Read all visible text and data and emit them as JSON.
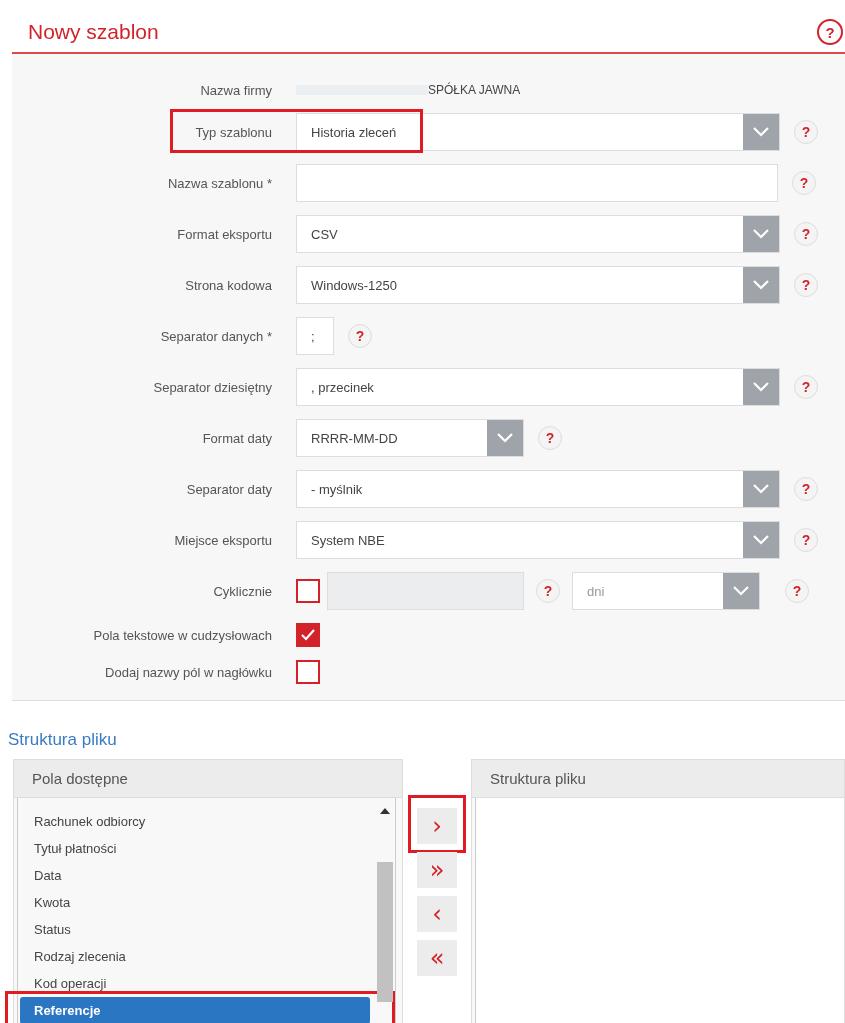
{
  "title": "Nowy szablon",
  "title_help": "?",
  "form": {
    "fields": [
      {
        "kind": "static",
        "label": "Nazwa firmy",
        "value": "SPÓŁKA JAWNA",
        "redacted": true
      },
      {
        "kind": "select",
        "label": "Typ szablonu",
        "value": "Historia zleceń",
        "help": "?",
        "highlighted": true
      },
      {
        "kind": "input",
        "label": "Nazwa szablonu *",
        "help": "?"
      },
      {
        "kind": "select",
        "label": "Format eksportu",
        "value": "CSV",
        "help": "?"
      },
      {
        "kind": "select",
        "label": "Strona kodowa",
        "value": "Windows-1250",
        "help": "?"
      },
      {
        "kind": "short-input",
        "label": "Separator danych *",
        "value": ";",
        "help": "?"
      },
      {
        "kind": "select",
        "label": "Separator dziesiętny",
        "value": ", przecinek",
        "help": "?"
      },
      {
        "kind": "short-select",
        "label": "Format daty",
        "value": "RRRR-MM-DD",
        "help": "?"
      },
      {
        "kind": "select",
        "label": "Separator daty",
        "value": "- myślnik",
        "help": "?"
      },
      {
        "kind": "select",
        "label": "Miejsce eksportu",
        "value": "System NBE",
        "help": "?"
      },
      {
        "kind": "cyclic",
        "label": "Cyklicznie",
        "checked": false,
        "help": "?",
        "unit": "dni",
        "unit_help": "?"
      },
      {
        "kind": "checkbox",
        "label": "Pola tekstowe w cudzysłowach",
        "checked": true
      },
      {
        "kind": "checkbox",
        "label": "Dodaj nazwy pól w nagłówku",
        "checked": false
      }
    ]
  },
  "structure": {
    "title": "Struktura pliku",
    "available": {
      "title": "Pola dostępne",
      "items": [
        {
          "label": "Rachunek odbiorcy",
          "selected": false
        },
        {
          "label": "Tytuł płatności",
          "selected": false
        },
        {
          "label": "Data",
          "selected": false
        },
        {
          "label": "Kwota",
          "selected": false
        },
        {
          "label": "Status",
          "selected": false
        },
        {
          "label": "Rodzaj zlecenia",
          "selected": false
        },
        {
          "label": "Kod operacji",
          "selected": false
        },
        {
          "label": "Referencje",
          "selected": true,
          "highlighted": true
        }
      ]
    },
    "buttons": [
      {
        "label": "›",
        "highlighted": true
      },
      {
        "label": "»",
        "highlighted": false
      },
      {
        "label": "‹",
        "highlighted": false
      },
      {
        "label": "«",
        "highlighted": false
      }
    ],
    "chosen": {
      "title": "Struktura pliku"
    }
  }
}
